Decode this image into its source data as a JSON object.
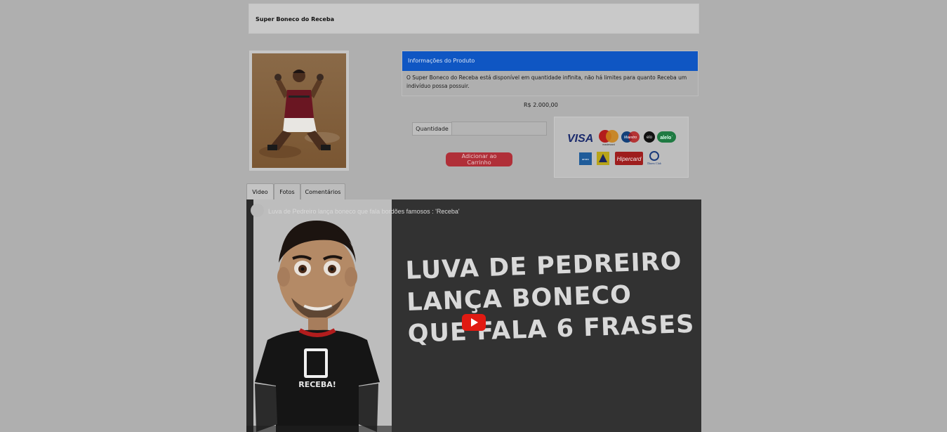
{
  "product": {
    "title": "Super Boneco do Receba",
    "info_header": "Informações do Produto",
    "description": "O Super Boneco do Receba está disponível em quantidade infinita, não há limites para quanto Receba um indivíduo possa possuir.",
    "price": "R$ 2.000,00"
  },
  "purchase": {
    "quantity_label": "Quantidade",
    "quantity_value": "",
    "add_to_cart_label": "Adicionar ao Carrinho"
  },
  "payment_methods": {
    "row1": [
      "VISA",
      "mastercard",
      "Maestro",
      "elo",
      "aleloˈ"
    ],
    "row2": [
      "amex",
      "bb",
      "Hipercard",
      "Diners Club"
    ]
  },
  "tabs": [
    {
      "label": "Video"
    },
    {
      "label": "Fotos"
    },
    {
      "label": "Comentários"
    }
  ],
  "video": {
    "title": "Luva de Pedreiro lança boneco que fala bordões famosos : 'Receba'",
    "headline": [
      "LUVA DE PEDREIRO",
      "LANÇA BONECO",
      "QUE FALA 6 FRASES"
    ],
    "shirt_text": "RECEBA!"
  }
}
